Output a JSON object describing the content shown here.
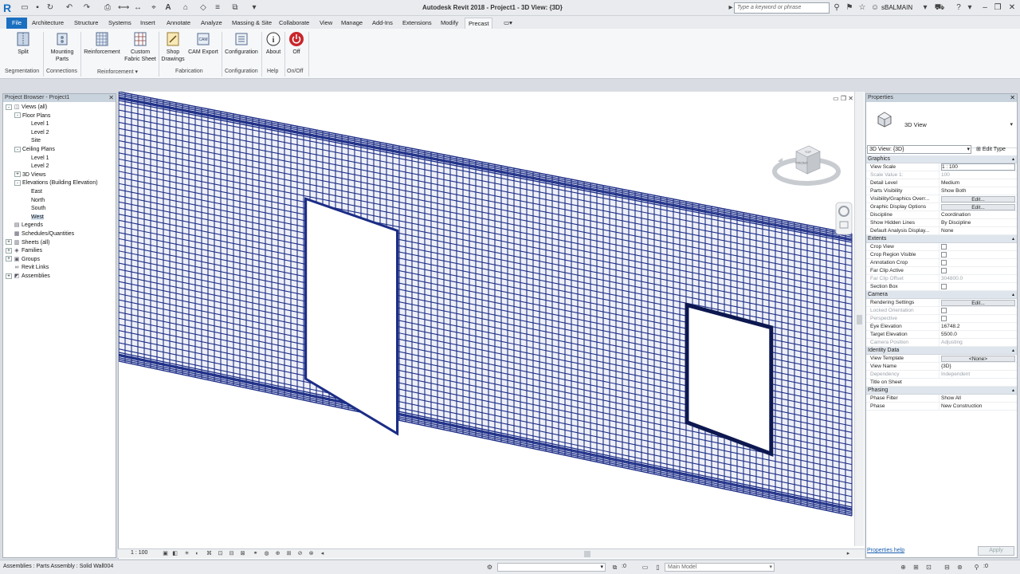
{
  "app": {
    "title": "Autodesk Revit 2018 -    Project1 - 3D View: {3D}",
    "logo": "R",
    "search_placeholder": "Type a keyword or phrase",
    "user": "sBALMAIN"
  },
  "tabs": [
    {
      "label": "File"
    },
    {
      "label": "Architecture"
    },
    {
      "label": "Structure"
    },
    {
      "label": "Systems"
    },
    {
      "label": "Insert"
    },
    {
      "label": "Annotate"
    },
    {
      "label": "Analyze"
    },
    {
      "label": "Massing & Site"
    },
    {
      "label": "Collaborate"
    },
    {
      "label": "View"
    },
    {
      "label": "Manage"
    },
    {
      "label": "Add-Ins"
    },
    {
      "label": "Extensions"
    },
    {
      "label": "Modify"
    },
    {
      "label": "Precast"
    }
  ],
  "ribbon": {
    "buttons": [
      {
        "label": "Split",
        "icon": "split-icon"
      },
      {
        "label": "Mounting Parts",
        "icon": "mounting-parts-icon"
      },
      {
        "label": "Reinforcement",
        "icon": "reinforcement-icon"
      },
      {
        "label": "Custom Fabric Sheet",
        "icon": "fabric-sheet-icon"
      },
      {
        "label": "Shop Drawings",
        "icon": "shop-drawings-icon"
      },
      {
        "label": "CAM Export",
        "icon": "cam-export-icon"
      },
      {
        "label": "Configuration",
        "icon": "configuration-icon"
      },
      {
        "label": "About",
        "icon": "about-icon"
      },
      {
        "label": "Off",
        "icon": "power-off-icon"
      }
    ],
    "panels": [
      "Segmentation",
      "Connections",
      "Reinforcement",
      "Fabrication",
      "Configuration",
      "Help",
      "On/Off"
    ]
  },
  "browser": {
    "title": "Project Browser - Project1",
    "tree": [
      {
        "label": "Views (all)",
        "level": 0,
        "toggle": "-",
        "glyph": "views"
      },
      {
        "label": "Floor Plans",
        "level": 1,
        "toggle": "-"
      },
      {
        "label": "Level 1",
        "level": 2
      },
      {
        "label": "Level 2",
        "level": 2
      },
      {
        "label": "Site",
        "level": 2
      },
      {
        "label": "Ceiling Plans",
        "level": 1,
        "toggle": "-"
      },
      {
        "label": "Level 1",
        "level": 2
      },
      {
        "label": "Level 2",
        "level": 2
      },
      {
        "label": "3D Views",
        "level": 1,
        "toggle": "+"
      },
      {
        "label": "Elevations (Building Elevation)",
        "level": 1,
        "toggle": "-"
      },
      {
        "label": "East",
        "level": 2
      },
      {
        "label": "North",
        "level": 2
      },
      {
        "label": "South",
        "level": 2
      },
      {
        "label": "West",
        "level": 2,
        "selected": true
      },
      {
        "label": "Legends",
        "level": 0,
        "glyph": "legend"
      },
      {
        "label": "Schedules/Quantities",
        "level": 0,
        "glyph": "schedule"
      },
      {
        "label": "Sheets (all)",
        "level": 0,
        "toggle": "+",
        "glyph": "sheet"
      },
      {
        "label": "Families",
        "level": 0,
        "toggle": "+",
        "glyph": "family"
      },
      {
        "label": "Groups",
        "level": 0,
        "toggle": "+",
        "glyph": "group"
      },
      {
        "label": "Revit Links",
        "level": 0,
        "glyph": "link"
      },
      {
        "label": "Assemblies",
        "level": 0,
        "toggle": "+",
        "glyph": "assembly"
      }
    ]
  },
  "viewport": {
    "mesh_color": "#1c2d86",
    "viewcube_top": "TOP",
    "viewcube_front": "FRONT"
  },
  "view_control": {
    "scale": "1 : 100"
  },
  "properties": {
    "title": "Properties",
    "type_name": "3D View",
    "instance_selector": "3D View: {3D}",
    "edit_type": "Edit Type",
    "groups": [
      {
        "name": "Graphics",
        "rows": [
          {
            "k": "View Scale",
            "v": "1 : 100",
            "kind": "input"
          },
          {
            "k": "Scale Value    1:",
            "v": "100",
            "dim": true
          },
          {
            "k": "Detail Level",
            "v": "Medium"
          },
          {
            "k": "Parts Visibility",
            "v": "Show Both"
          },
          {
            "k": "Visibility/Graphics Overr...",
            "v": "Edit...",
            "kind": "btn"
          },
          {
            "k": "Graphic Display Options",
            "v": "Edit...",
            "kind": "btn"
          },
          {
            "k": "Discipline",
            "v": "Coordination"
          },
          {
            "k": "Show Hidden Lines",
            "v": "By Discipline"
          },
          {
            "k": "Default Analysis Display...",
            "v": "None"
          }
        ]
      },
      {
        "name": "Extents",
        "rows": [
          {
            "k": "Crop View",
            "v": "",
            "kind": "chk"
          },
          {
            "k": "Crop Region Visible",
            "v": "",
            "kind": "chk"
          },
          {
            "k": "Annotation Crop",
            "v": "",
            "kind": "chk"
          },
          {
            "k": "Far Clip Active",
            "v": "",
            "kind": "chk"
          },
          {
            "k": "Far Clip Offset",
            "v": "304800.0",
            "dim": true
          },
          {
            "k": "Section Box",
            "v": "",
            "kind": "chk"
          }
        ]
      },
      {
        "name": "Camera",
        "rows": [
          {
            "k": "Rendering Settings",
            "v": "Edit...",
            "kind": "btn"
          },
          {
            "k": "Locked Orientation",
            "v": "",
            "kind": "chk",
            "dim": true
          },
          {
            "k": "Perspective",
            "v": "",
            "kind": "chk",
            "dim": true
          },
          {
            "k": "Eye Elevation",
            "v": "16748.2"
          },
          {
            "k": "Target Elevation",
            "v": "5500.0"
          },
          {
            "k": "Camera Position",
            "v": "Adjusting",
            "dim": true
          }
        ]
      },
      {
        "name": "Identity Data",
        "rows": [
          {
            "k": "View Template",
            "v": "<None>",
            "kind": "btn"
          },
          {
            "k": "View Name",
            "v": "{3D}"
          },
          {
            "k": "Dependency",
            "v": "Independent",
            "dim": true
          },
          {
            "k": "Title on Sheet",
            "v": ""
          }
        ]
      },
      {
        "name": "Phasing",
        "rows": [
          {
            "k": "Phase Filter",
            "v": "Show All"
          },
          {
            "k": "Phase",
            "v": "New Construction"
          }
        ]
      }
    ],
    "help_link": "Properties help",
    "apply": "Apply"
  },
  "status": {
    "text": "Assemblies : Parts Assembly : Solid Wall004",
    "zero": ":0",
    "model": "Main Model"
  }
}
